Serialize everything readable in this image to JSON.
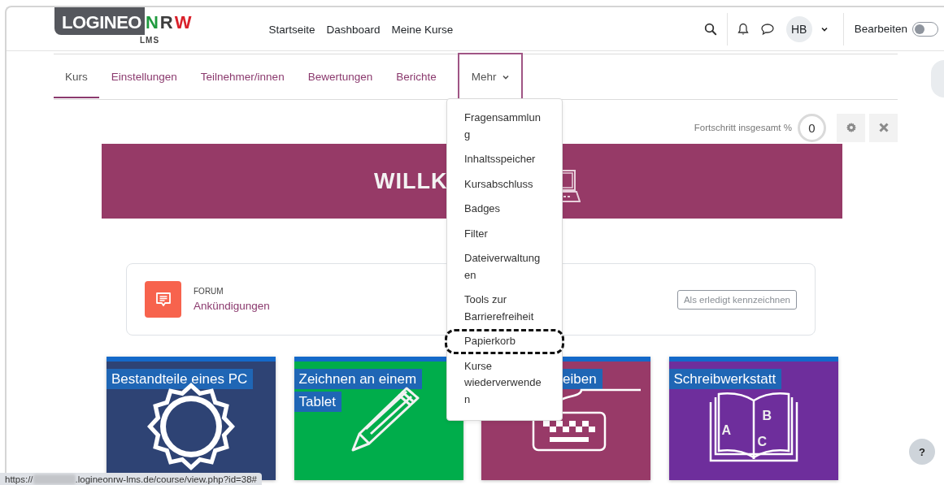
{
  "header": {
    "logo": {
      "parts": [
        {
          "text": "LOGINEO",
          "kind": "boxed",
          "color": "#55575d"
        },
        {
          "text": "N",
          "kind": "plain",
          "color": "#1f9a3e"
        },
        {
          "text": "R",
          "kind": "plain",
          "color": "#3d3d3d"
        },
        {
          "text": "W",
          "kind": "plain",
          "color": "#d9202a"
        }
      ],
      "subtitle": "LMS"
    },
    "nav": [
      "Startseite",
      "Dashboard",
      "Meine Kurse"
    ],
    "avatar": "HB",
    "edit_label": "Bearbeiten",
    "edit_mode": false
  },
  "course_tabs": [
    {
      "label": "Kurs",
      "selected": true,
      "kind": "link"
    },
    {
      "label": "Einstellungen",
      "selected": false,
      "kind": "link"
    },
    {
      "label": "Teilnehmer/innen",
      "selected": false,
      "kind": "link"
    },
    {
      "label": "Bewertungen",
      "selected": false,
      "kind": "link"
    },
    {
      "label": "Berichte",
      "selected": false,
      "kind": "link"
    },
    {
      "label": "Mehr",
      "selected": false,
      "kind": "menu",
      "expanded": true
    }
  ],
  "more_menu": [
    {
      "label": "Fragensammlung",
      "annotated": false
    },
    {
      "label": "Inhaltsspeicher",
      "annotated": false
    },
    {
      "label": "Kursabschluss",
      "annotated": false
    },
    {
      "label": "Badges",
      "annotated": false
    },
    {
      "label": "Filter",
      "annotated": false
    },
    {
      "label": "Dateiverwaltungen",
      "annotated": false
    },
    {
      "label": "Tools zur Barrierefreiheit",
      "annotated": false
    },
    {
      "label": "Papierkorb",
      "annotated": true
    },
    {
      "label": "Kurse wiederverwenden",
      "annotated": false
    }
  ],
  "progress": {
    "label": "Fortschritt insgesamt %",
    "value": "0"
  },
  "banner": {
    "title": "WILLK"
  },
  "forum": {
    "type": "FORUM",
    "name": "Ankündigungen",
    "button": "Als erledigt kennzeichnen"
  },
  "tiles": [
    {
      "title": "Bestandteile eines PC",
      "color": "#2e4374",
      "kind": "sun",
      "covered": false
    },
    {
      "title": "Zeichnen an einem Tablet",
      "color": "#00ad4b",
      "kind": "pencil",
      "covered": false
    },
    {
      "title": "eiben",
      "color": "#983a68",
      "kind": "keyboard",
      "covered": true
    },
    {
      "title": "Schreibwerkstatt",
      "color": "#6e2e9c",
      "kind": "book",
      "covered": false,
      "letters": [
        "A",
        "B",
        "C"
      ]
    }
  ],
  "status_url": {
    "prefix": "https://",
    "rest": ".logineonrw-lms.de/course/view.php?id=38#"
  },
  "help": "?"
}
